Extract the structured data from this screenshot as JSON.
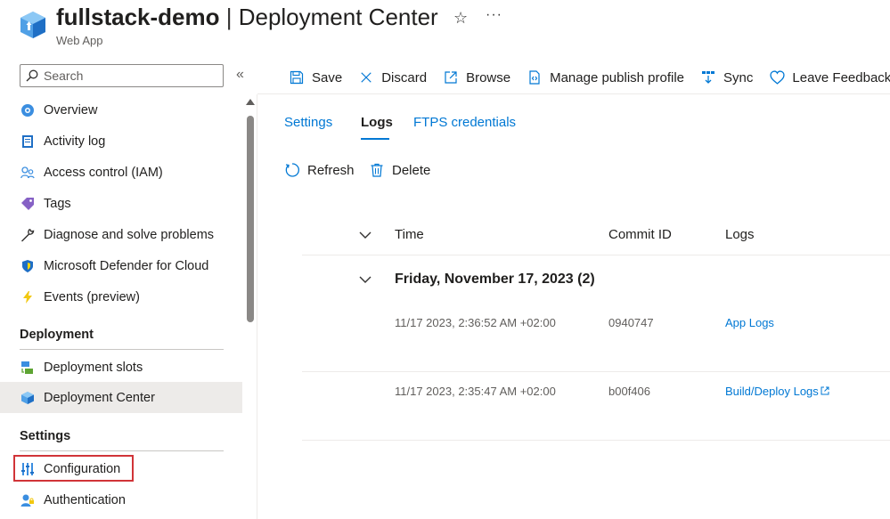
{
  "header": {
    "title_name": "fullstack-demo",
    "title_separator": " | ",
    "title_page": "Deployment Center",
    "subtitle": "Web App",
    "star_icon": "star-icon",
    "more_icon": "ellipsis-icon"
  },
  "sidebar": {
    "search_placeholder": "Search",
    "collapse_glyph": "«",
    "items_top": [
      {
        "label": "Overview",
        "icon": "overview-icon"
      },
      {
        "label": "Activity log",
        "icon": "activity-log-icon"
      },
      {
        "label": "Access control (IAM)",
        "icon": "iam-icon"
      },
      {
        "label": "Tags",
        "icon": "tag-icon"
      },
      {
        "label": "Diagnose and solve problems",
        "icon": "wrench-icon"
      },
      {
        "label": "Microsoft Defender for Cloud",
        "icon": "shield-icon"
      },
      {
        "label": "Events (preview)",
        "icon": "lightning-icon"
      }
    ],
    "section_deployment": "Deployment",
    "items_deployment": [
      {
        "label": "Deployment slots",
        "icon": "slots-icon"
      },
      {
        "label": "Deployment Center",
        "icon": "cube-icon",
        "active": true
      }
    ],
    "section_settings": "Settings",
    "items_settings": [
      {
        "label": "Configuration",
        "icon": "sliders-icon",
        "highlighted": true
      },
      {
        "label": "Authentication",
        "icon": "auth-icon"
      }
    ]
  },
  "toolbar": {
    "save": "Save",
    "discard": "Discard",
    "browse": "Browse",
    "manage_publish_profile": "Manage publish profile",
    "sync": "Sync",
    "leave_feedback": "Leave Feedback"
  },
  "tabs": [
    {
      "label": "Settings",
      "active": false
    },
    {
      "label": "Logs",
      "active": true
    },
    {
      "label": "FTPS credentials",
      "active": false
    }
  ],
  "actions": {
    "refresh": "Refresh",
    "delete": "Delete"
  },
  "table": {
    "columns": [
      "Time",
      "Commit ID",
      "Logs"
    ],
    "group_title": "Friday, November 17, 2023 (2)",
    "rows": [
      {
        "time": "11/17 2023, 2:36:52 AM +02:00",
        "commit": "0940747",
        "logs": "App Logs"
      },
      {
        "time": "11/17 2023, 2:35:47 AM +02:00",
        "commit": "b00f406",
        "logs": "Build/Deploy Logs"
      }
    ]
  },
  "colors": {
    "accent": "#0078d4",
    "highlight_border": "#d13438",
    "active_nav_bg": "#edebe9"
  }
}
